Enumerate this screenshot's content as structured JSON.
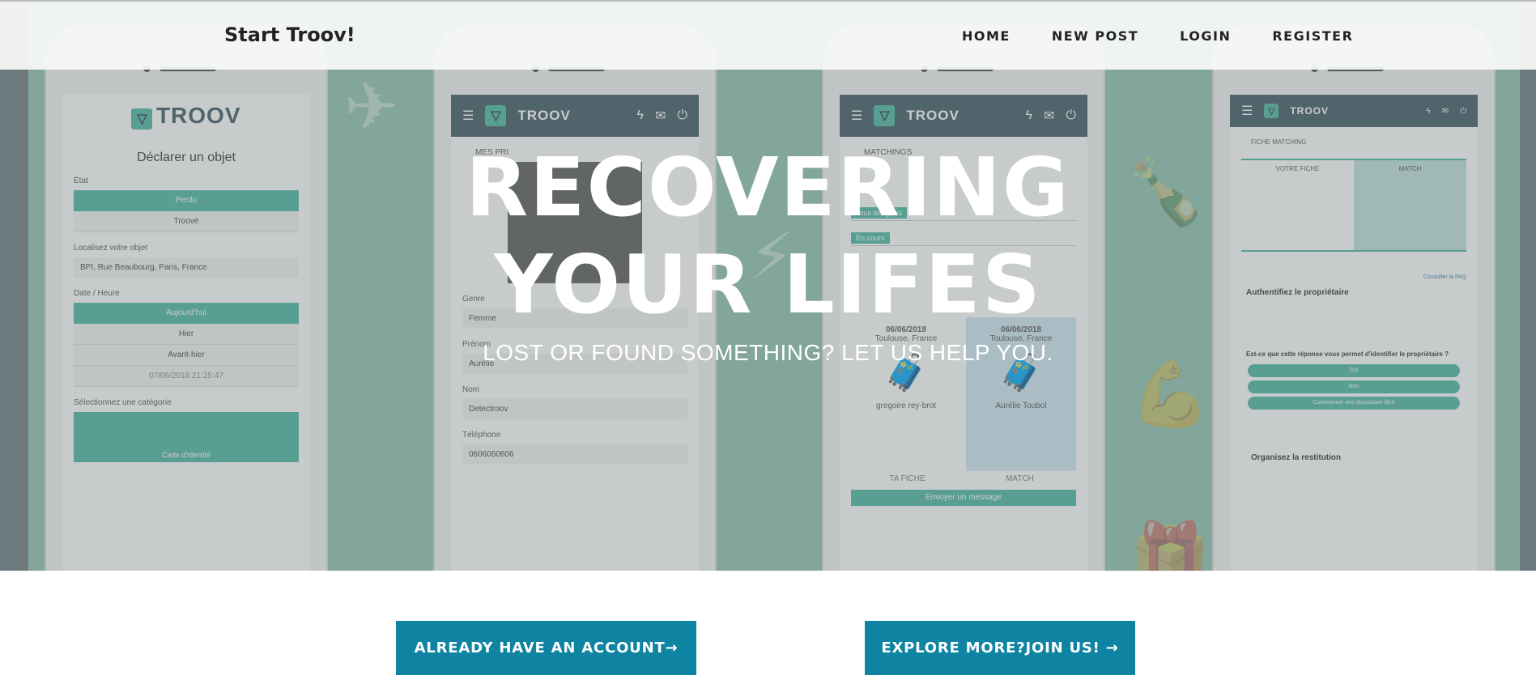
{
  "navbar": {
    "brand": "Start Troov!",
    "links": [
      "HOME",
      "NEW POST",
      "LOGIN",
      "REGISTER"
    ]
  },
  "hero": {
    "headline_line1": "RECOVERING",
    "headline_line2": "YOUR LIFES",
    "subheadline": "LOST OR FOUND SOMETHING? LET US HELP YOU."
  },
  "cta": {
    "login_label": "ALREADY HAVE AN ACCOUNT→",
    "join_label": "EXPLORE MORE?JOIN US! →"
  },
  "phone1": {
    "logo": "TROOV",
    "title": "Déclarer un objet",
    "etat_label": "État",
    "etat_options": [
      "Perdu",
      "Troové"
    ],
    "location_label": "Localisez votre objet",
    "location_value": "BPI, Rue Beaubourg, Paris, France",
    "date_label": "Date / Heure",
    "date_options": [
      "Aujourd'hui",
      "Hier",
      "Avant-hier"
    ],
    "datetime": "07/06/2018 21:25:47",
    "category_label": "Sélectionnez une catégorie",
    "category": "Carte d'identité"
  },
  "phone2": {
    "logo": "TROOV",
    "section": "MES PRI",
    "genre_label": "Genre",
    "genre_value": "Femme",
    "prenom_label": "Prénom",
    "prenom_value": "Aurélie",
    "nom_label": "Nom",
    "nom_value": "Detectroov",
    "tel_label": "Téléphone",
    "tel_value": "0606060606"
  },
  "phone3": {
    "logo": "TROOV",
    "section": "MATCHINGS",
    "filter1": "Tous les types",
    "filter2": "En cours",
    "card1_date": "06/06/2018",
    "card1_city": "Toulouse, France",
    "card1_name": "gregoire rey-brot",
    "card2_date": "06/06/2018",
    "card2_city": "Toulouse, France",
    "card2_name": "Aurélie Toubol",
    "tab1": "TA FICHE",
    "tab2": "MATCH",
    "send": "Envoyer un message"
  },
  "phone4": {
    "logo": "TROOV",
    "section": "FICHE MATCHING",
    "col1": "VOTRE FICHE",
    "col2": "MATCH",
    "faq": "Consulter la FAQ",
    "auth_title": "Authentifiez le propriétaire",
    "question": "Est-ce que cette réponse vous permet d'identifier le propriétaire ?",
    "btn_yes": "Oui",
    "btn_no": "Non",
    "btn_chat": "Commencer une discussion libre",
    "restitution": "Organisez la restitution"
  },
  "colors": {
    "accent": "#0e84a2",
    "teal": "#4db6a2",
    "appbar": "#3e5a63"
  }
}
